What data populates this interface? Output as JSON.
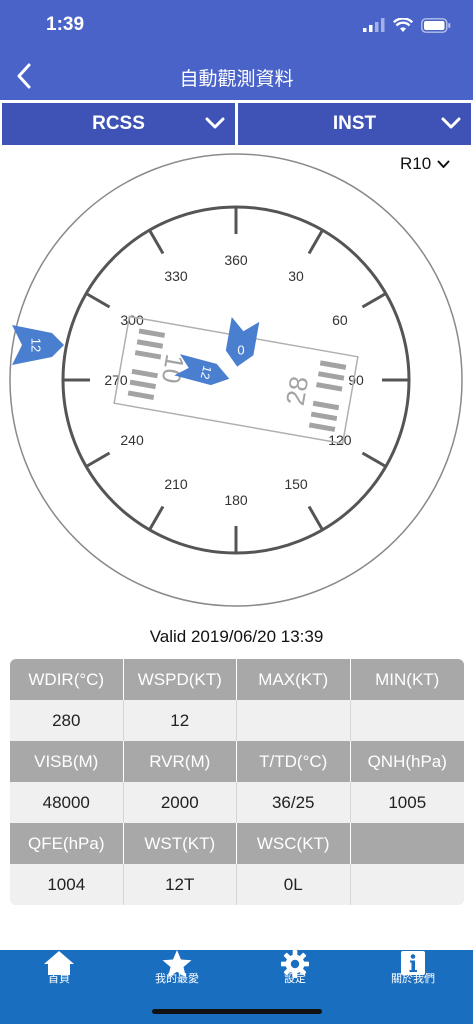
{
  "status_bar": {
    "time": "1:39"
  },
  "header": {
    "title": "自動觀測資料"
  },
  "selectors": {
    "station": "RCSS",
    "mode": "INST",
    "runway": "R10"
  },
  "compass": {
    "headings": [
      "360",
      "30",
      "60",
      "90",
      "120",
      "150",
      "180",
      "210",
      "240",
      "270",
      "300",
      "330"
    ],
    "runway_left_number": "10",
    "runway_right_number": "28",
    "outer_arrow_label": "12",
    "wind_arrow_label": "12",
    "direction_arrow_label": "0",
    "wind_direction_deg": 280
  },
  "valid": "Valid 2019/06/20 13:39",
  "table": {
    "rows": [
      [
        "WDIR(°C)",
        "WSPD(KT)",
        "MAX(KT)",
        "MIN(KT)"
      ],
      [
        "280",
        "12",
        "",
        ""
      ],
      [
        "VISB(M)",
        "RVR(M)",
        "T/TD(°C)",
        "QNH(hPa)"
      ],
      [
        "48000",
        "2000",
        "36/25",
        "1005"
      ],
      [
        "QFE(hPa)",
        "WST(KT)",
        "WSC(KT)",
        ""
      ],
      [
        "1004",
        "12T",
        "0L",
        ""
      ]
    ]
  },
  "tabs": [
    {
      "label": "首頁",
      "icon": "home-icon"
    },
    {
      "label": "我的最愛",
      "icon": "star-icon"
    },
    {
      "label": "設定",
      "icon": "gear-icon"
    },
    {
      "label": "關於我們",
      "icon": "info-icon"
    }
  ],
  "colors": {
    "header": "#4a63c9",
    "selector": "#3f52b5",
    "tabbar": "#1a6ec0",
    "arrow": "#4a7fd0"
  }
}
